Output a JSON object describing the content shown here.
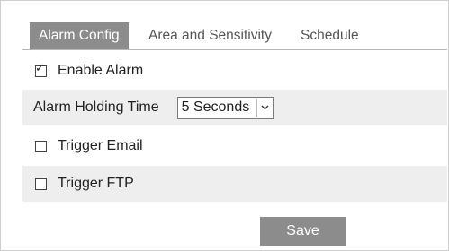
{
  "tabs": [
    {
      "label": "Alarm Config",
      "active": true
    },
    {
      "label": "Area and Sensitivity",
      "active": false
    },
    {
      "label": "Schedule",
      "active": false
    }
  ],
  "enable_alarm": {
    "label": "Enable Alarm",
    "checked": true,
    "check_glyph": "✓"
  },
  "alarm_holding": {
    "label": "Alarm Holding Time",
    "value": "5 Seconds",
    "arrow_icon": "chevron-down-icon"
  },
  "trigger_email": {
    "label": "Trigger Email",
    "checked": false
  },
  "trigger_ftp": {
    "label": "Trigger FTP",
    "checked": false
  },
  "save_label": "Save",
  "colors": {
    "active_tab": "#8c8c8c",
    "shaded_row": "#eeeeee",
    "button": "#8c8c8c"
  }
}
